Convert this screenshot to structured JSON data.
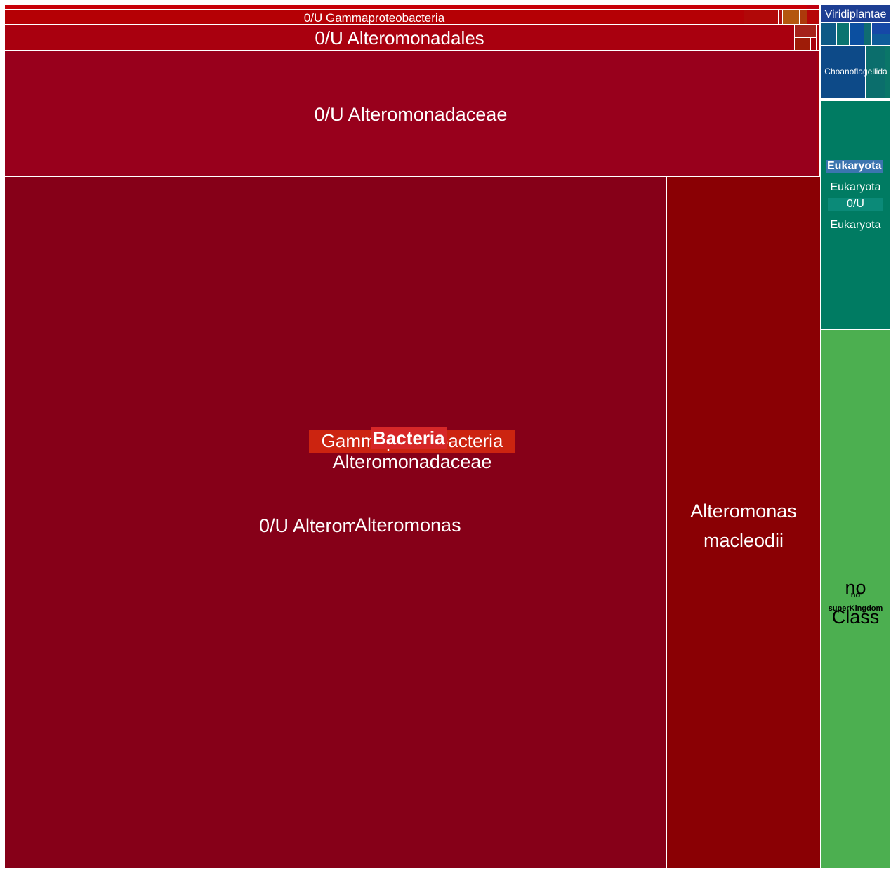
{
  "chart_data": {
    "type": "treemap",
    "title": "",
    "superkingdoms": [
      {
        "name": "Bacteria",
        "color": "#d62728"
      },
      {
        "name": "Eukaryota",
        "color": "#3b75af"
      },
      {
        "name": "no superKingdom",
        "color": ""
      }
    ],
    "labels": {
      "gamma_unassigned": "0/U Gammaproteobacteria",
      "altero_order_unassigned": "0/U Alteromonadales",
      "altero_family_unassigned": "0/U Alteromonadaceae",
      "gammaproteobacteria": "Gammaproteobacteria",
      "alteromonadaceae": "Alteromonadaceae",
      "altero_genus_unassigned": "0/U Alteromonas",
      "alteromonas": "Alteromonas",
      "alteromonas_macleodii_line1": "Alteromonas",
      "alteromonas_macleodii_line2": "macleodii",
      "viridiplantae": "Viridiplantae",
      "choanoflagellida": "Choanoflagellida",
      "eukaryota_line1": "Eukaryota",
      "eukaryota_line2": "0/U",
      "eukaryota_line3": "Eukaryota",
      "no_class_line1": "no",
      "no_class_line2": "Class",
      "no_superkingdom_line1": "no",
      "no_superkingdom_line2": "superKingdom"
    },
    "colors": {
      "gamma_unassigned": "#b50005",
      "altero_order_unassigned": "#a9000f",
      "altero_family_unassigned": "#98001c",
      "altero_genus_unassigned": "#860018",
      "alteromonas_macleodii": "#8a0004",
      "eukaryota_main": "#007b62",
      "viridiplantae": "#1d3e93",
      "choanoflagellida": "#0d4a88",
      "no_superkingdom": "#4caf50"
    }
  }
}
